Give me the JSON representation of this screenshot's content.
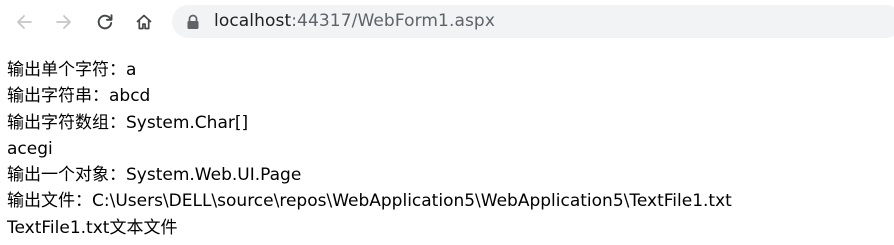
{
  "browser": {
    "back_icon": "arrow-left-icon",
    "forward_icon": "arrow-right-icon",
    "reload_icon": "reload-icon",
    "home_icon": "home-icon",
    "lock_icon": "lock-icon",
    "url_host": "localhost",
    "url_rest": ":44317/WebForm1.aspx"
  },
  "page": {
    "lines": [
      "输出单个字符：a",
      "输出字符串：abcd",
      "输出字符数组：System.Char[]",
      "acegi",
      "输出一个对象：System.Web.UI.Page",
      "输出文件：C:\\Users\\DELL\\source\\repos\\WebApplication5\\WebApplication5\\TextFile1.txt",
      "TextFile1.txt文本文件"
    ]
  },
  "colors": {
    "toolbar_bg": "#ffffff",
    "omnibox_bg": "#f1f3f4",
    "icon": "#5f6368",
    "disabled_icon": "#c4c7c5",
    "text": "#000000"
  }
}
